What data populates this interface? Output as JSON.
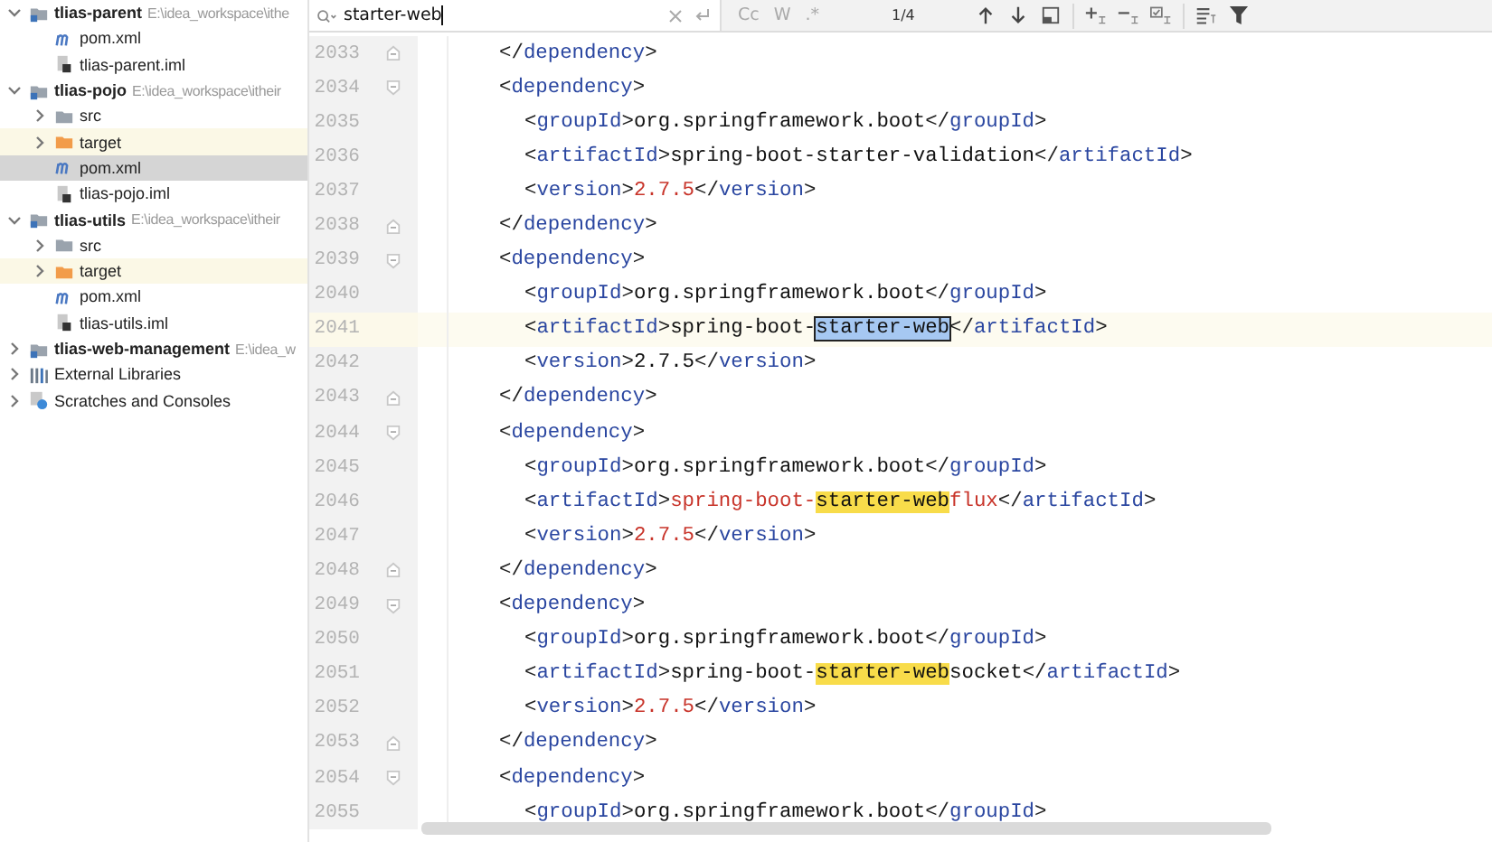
{
  "project_tree": [
    {
      "label": "tlias-parent",
      "path": "E:\\idea_workspace\\ithe",
      "kind": "module",
      "expanded": true,
      "selected": false,
      "children": [
        {
          "label": "pom.xml",
          "kind": "maven",
          "selected": false
        },
        {
          "label": "tlias-parent.iml",
          "kind": "iml",
          "selected": false
        }
      ]
    },
    {
      "label": "tlias-pojo",
      "path": "E:\\idea_workspace\\itheir",
      "kind": "module",
      "expanded": true,
      "selected": false,
      "children": [
        {
          "label": "src",
          "kind": "folder",
          "expanded": false,
          "selected": false
        },
        {
          "label": "target",
          "kind": "excluded",
          "expanded": false,
          "selected": false
        },
        {
          "label": "pom.xml",
          "kind": "maven",
          "selected": true
        },
        {
          "label": "tlias-pojo.iml",
          "kind": "iml",
          "selected": false
        }
      ]
    },
    {
      "label": "tlias-utils",
      "path": "E:\\idea_workspace\\itheir",
      "kind": "module",
      "expanded": true,
      "selected": false,
      "children": [
        {
          "label": "src",
          "kind": "folder",
          "expanded": false,
          "selected": false
        },
        {
          "label": "target",
          "kind": "excluded",
          "expanded": false,
          "selected": false
        },
        {
          "label": "pom.xml",
          "kind": "maven",
          "selected": false
        },
        {
          "label": "tlias-utils.iml",
          "kind": "iml",
          "selected": false
        }
      ]
    },
    {
      "label": "tlias-web-management",
      "path": "E:\\idea_w",
      "kind": "module",
      "expanded": false,
      "selected": false
    },
    {
      "label": "External Libraries",
      "kind": "libraries",
      "expanded": false,
      "selected": false
    },
    {
      "label": "Scratches and Consoles",
      "kind": "scratches",
      "expanded": false,
      "selected": false
    }
  ],
  "search": {
    "value": "starter-web",
    "options": [
      {
        "label": "Cc",
        "on": false
      },
      {
        "label": "W",
        "on": false
      },
      {
        "label": ".*",
        "on": false
      }
    ],
    "count": "1/4"
  },
  "code_lines": [
    {
      "number": "2033",
      "kind": "parent",
      "fold_start": false,
      "fold_end": true,
      "current": false,
      "segments": [
        {
          "kind": "punct",
          "text": "</"
        },
        {
          "kind": "tag",
          "text": "dependency"
        },
        {
          "kind": "punct",
          "text": ">"
        }
      ]
    },
    {
      "number": "2034",
      "kind": "parent",
      "fold_start": true,
      "fold_end": false,
      "current": false,
      "segments": [
        {
          "kind": "punct",
          "text": "<"
        },
        {
          "kind": "tag",
          "text": "dependency"
        },
        {
          "kind": "punct",
          "text": ">"
        }
      ]
    },
    {
      "number": "2035",
      "kind": "child",
      "fold_start": false,
      "fold_end": false,
      "current": false,
      "segments": [
        {
          "kind": "punct",
          "text": "<"
        },
        {
          "kind": "tag",
          "text": "groupId"
        },
        {
          "kind": "punct",
          "text": ">"
        },
        {
          "kind": "text",
          "text": "org.springframework.boot"
        },
        {
          "kind": "punct",
          "text": "</"
        },
        {
          "kind": "tag",
          "text": "groupId"
        },
        {
          "kind": "punct",
          "text": ">"
        }
      ]
    },
    {
      "number": "2036",
      "kind": "child",
      "fold_start": false,
      "fold_end": false,
      "current": false,
      "segments": [
        {
          "kind": "punct",
          "text": "<"
        },
        {
          "kind": "tag",
          "text": "artifactId"
        },
        {
          "kind": "punct",
          "text": ">"
        },
        {
          "kind": "text",
          "text": "spring-boot-starter-validation"
        },
        {
          "kind": "punct",
          "text": "</"
        },
        {
          "kind": "tag",
          "text": "artifactId"
        },
        {
          "kind": "punct",
          "text": ">"
        }
      ]
    },
    {
      "number": "2037",
      "kind": "child",
      "fold_start": false,
      "fold_end": false,
      "current": false,
      "segments": [
        {
          "kind": "punct",
          "text": "<"
        },
        {
          "kind": "tag",
          "text": "version"
        },
        {
          "kind": "punct",
          "text": ">"
        },
        {
          "kind": "value",
          "text": "2.7.5"
        },
        {
          "kind": "punct",
          "text": "</"
        },
        {
          "kind": "tag",
          "text": "version"
        },
        {
          "kind": "punct",
          "text": ">"
        }
      ]
    },
    {
      "number": "2038",
      "kind": "parent",
      "fold_start": false,
      "fold_end": true,
      "current": false,
      "segments": [
        {
          "kind": "punct",
          "text": "</"
        },
        {
          "kind": "tag",
          "text": "dependency"
        },
        {
          "kind": "punct",
          "text": ">"
        }
      ]
    },
    {
      "number": "2039",
      "kind": "parent",
      "fold_start": true,
      "fold_end": false,
      "current": false,
      "segments": [
        {
          "kind": "punct",
          "text": "<"
        },
        {
          "kind": "tag",
          "text": "dependency"
        },
        {
          "kind": "punct",
          "text": ">"
        }
      ]
    },
    {
      "number": "2040",
      "kind": "child",
      "fold_start": false,
      "fold_end": false,
      "current": false,
      "segments": [
        {
          "kind": "punct",
          "text": "<"
        },
        {
          "kind": "tag",
          "text": "groupId"
        },
        {
          "kind": "punct",
          "text": ">"
        },
        {
          "kind": "text",
          "text": "org.springframework.boot"
        },
        {
          "kind": "punct",
          "text": "</"
        },
        {
          "kind": "tag",
          "text": "groupId"
        },
        {
          "kind": "punct",
          "text": ">"
        }
      ]
    },
    {
      "number": "2041",
      "kind": "child",
      "fold_start": false,
      "fold_end": false,
      "current": true,
      "segments": [
        {
          "kind": "punct",
          "text": "<"
        },
        {
          "kind": "tag",
          "text": "artifactId"
        },
        {
          "kind": "punct",
          "text": ">"
        },
        {
          "kind": "text",
          "text": "spring-boot-"
        },
        {
          "kind": "current-match",
          "text": "starter-web"
        },
        {
          "kind": "punct",
          "text": "</"
        },
        {
          "kind": "tag",
          "text": "artifactId"
        },
        {
          "kind": "punct",
          "text": ">"
        }
      ]
    },
    {
      "number": "2042",
      "kind": "child",
      "fold_start": false,
      "fold_end": false,
      "current": false,
      "segments": [
        {
          "kind": "punct",
          "text": "<"
        },
        {
          "kind": "tag",
          "text": "version"
        },
        {
          "kind": "punct",
          "text": ">"
        },
        {
          "kind": "text",
          "text": "2.7.5"
        },
        {
          "kind": "punct",
          "text": "</"
        },
        {
          "kind": "tag",
          "text": "version"
        },
        {
          "kind": "punct",
          "text": ">"
        }
      ]
    },
    {
      "number": "2043",
      "kind": "parent",
      "fold_start": false,
      "fold_end": true,
      "current": false,
      "segments": [
        {
          "kind": "punct",
          "text": "</"
        },
        {
          "kind": "tag",
          "text": "dependency"
        },
        {
          "kind": "punct",
          "text": ">"
        }
      ]
    },
    {
      "number": "2044",
      "kind": "parent",
      "fold_start": true,
      "fold_end": false,
      "current": false,
      "segments": [
        {
          "kind": "punct",
          "text": "<"
        },
        {
          "kind": "tag",
          "text": "dependency"
        },
        {
          "kind": "punct",
          "text": ">"
        }
      ]
    },
    {
      "number": "2045",
      "kind": "child",
      "fold_start": false,
      "fold_end": false,
      "current": false,
      "segments": [
        {
          "kind": "punct",
          "text": "<"
        },
        {
          "kind": "tag",
          "text": "groupId"
        },
        {
          "kind": "punct",
          "text": ">"
        },
        {
          "kind": "text",
          "text": "org.springframework.boot"
        },
        {
          "kind": "punct",
          "text": "</"
        },
        {
          "kind": "tag",
          "text": "groupId"
        },
        {
          "kind": "punct",
          "text": ">"
        }
      ]
    },
    {
      "number": "2046",
      "kind": "child",
      "fold_start": false,
      "fold_end": false,
      "current": false,
      "segments": [
        {
          "kind": "punct",
          "text": "<"
        },
        {
          "kind": "tag",
          "text": "artifactId"
        },
        {
          "kind": "punct",
          "text": ">"
        },
        {
          "kind": "value",
          "text": "spring-boot-"
        },
        {
          "kind": "match",
          "text": "starter-web"
        },
        {
          "kind": "value",
          "text": "flux"
        },
        {
          "kind": "punct",
          "text": "</"
        },
        {
          "kind": "tag",
          "text": "artifactId"
        },
        {
          "kind": "punct",
          "text": ">"
        }
      ]
    },
    {
      "number": "2047",
      "kind": "child",
      "fold_start": false,
      "fold_end": false,
      "current": false,
      "segments": [
        {
          "kind": "punct",
          "text": "<"
        },
        {
          "kind": "tag",
          "text": "version"
        },
        {
          "kind": "punct",
          "text": ">"
        },
        {
          "kind": "value",
          "text": "2.7.5"
        },
        {
          "kind": "punct",
          "text": "</"
        },
        {
          "kind": "tag",
          "text": "version"
        },
        {
          "kind": "punct",
          "text": ">"
        }
      ]
    },
    {
      "number": "2048",
      "kind": "parent",
      "fold_start": false,
      "fold_end": true,
      "current": false,
      "segments": [
        {
          "kind": "punct",
          "text": "</"
        },
        {
          "kind": "tag",
          "text": "dependency"
        },
        {
          "kind": "punct",
          "text": ">"
        }
      ]
    },
    {
      "number": "2049",
      "kind": "parent",
      "fold_start": true,
      "fold_end": false,
      "current": false,
      "segments": [
        {
          "kind": "punct",
          "text": "<"
        },
        {
          "kind": "tag",
          "text": "dependency"
        },
        {
          "kind": "punct",
          "text": ">"
        }
      ]
    },
    {
      "number": "2050",
      "kind": "child",
      "fold_start": false,
      "fold_end": false,
      "current": false,
      "segments": [
        {
          "kind": "punct",
          "text": "<"
        },
        {
          "kind": "tag",
          "text": "groupId"
        },
        {
          "kind": "punct",
          "text": ">"
        },
        {
          "kind": "text",
          "text": "org.springframework.boot"
        },
        {
          "kind": "punct",
          "text": "</"
        },
        {
          "kind": "tag",
          "text": "groupId"
        },
        {
          "kind": "punct",
          "text": ">"
        }
      ]
    },
    {
      "number": "2051",
      "kind": "child",
      "fold_start": false,
      "fold_end": false,
      "current": false,
      "segments": [
        {
          "kind": "punct",
          "text": "<"
        },
        {
          "kind": "tag",
          "text": "artifactId"
        },
        {
          "kind": "punct",
          "text": ">"
        },
        {
          "kind": "text",
          "text": "spring-boot-"
        },
        {
          "kind": "match",
          "text": "starter-web"
        },
        {
          "kind": "text",
          "text": "socket"
        },
        {
          "kind": "punct",
          "text": "</"
        },
        {
          "kind": "tag",
          "text": "artifactId"
        },
        {
          "kind": "punct",
          "text": ">"
        }
      ]
    },
    {
      "number": "2052",
      "kind": "child",
      "fold_start": false,
      "fold_end": false,
      "current": false,
      "segments": [
        {
          "kind": "punct",
          "text": "<"
        },
        {
          "kind": "tag",
          "text": "version"
        },
        {
          "kind": "punct",
          "text": ">"
        },
        {
          "kind": "value",
          "text": "2.7.5"
        },
        {
          "kind": "punct",
          "text": "</"
        },
        {
          "kind": "tag",
          "text": "version"
        },
        {
          "kind": "punct",
          "text": ">"
        }
      ]
    },
    {
      "number": "2053",
      "kind": "parent",
      "fold_start": false,
      "fold_end": true,
      "current": false,
      "segments": [
        {
          "kind": "punct",
          "text": "</"
        },
        {
          "kind": "tag",
          "text": "dependency"
        },
        {
          "kind": "punct",
          "text": ">"
        }
      ]
    },
    {
      "number": "2054",
      "kind": "parent",
      "fold_start": true,
      "fold_end": false,
      "current": false,
      "segments": [
        {
          "kind": "punct",
          "text": "<"
        },
        {
          "kind": "tag",
          "text": "dependency"
        },
        {
          "kind": "punct",
          "text": ">"
        }
      ]
    },
    {
      "number": "2055",
      "kind": "child",
      "fold_start": false,
      "fold_end": false,
      "current": false,
      "segments": [
        {
          "kind": "punct",
          "text": "<"
        },
        {
          "kind": "tag",
          "text": "groupId"
        },
        {
          "kind": "punct",
          "text": ">"
        },
        {
          "kind": "text",
          "text": "org.springframework.boot"
        },
        {
          "kind": "punct",
          "text": "</"
        },
        {
          "kind": "tag",
          "text": "groupId"
        },
        {
          "kind": "punct",
          "text": ">"
        }
      ]
    }
  ]
}
